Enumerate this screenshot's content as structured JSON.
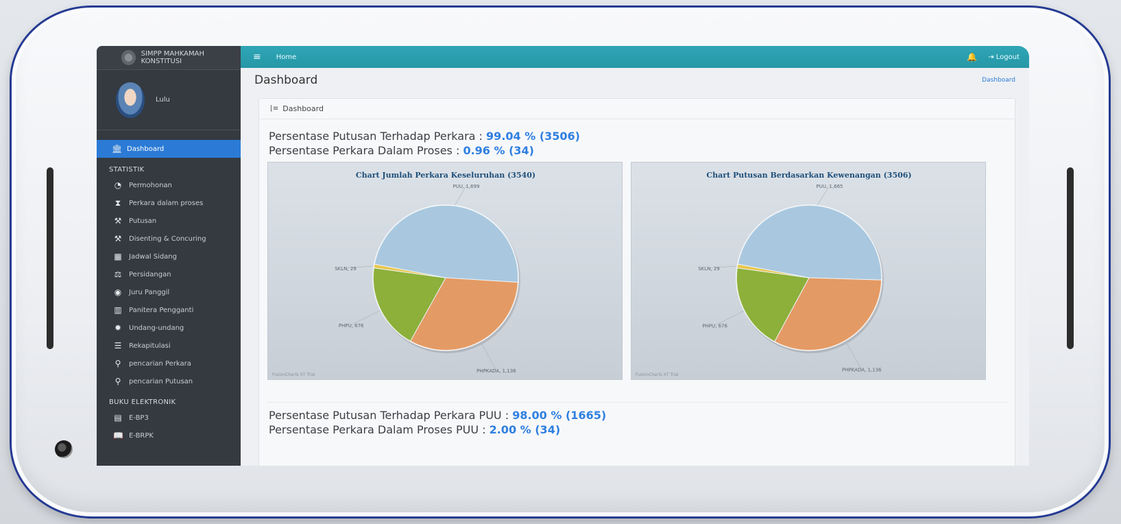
{
  "app": {
    "brand": "SIMPP MAHKAMAH KONSTITUSI",
    "user_name": "Lulu"
  },
  "topbar": {
    "home_label": "Home",
    "logout_label": "Logout"
  },
  "sidebar": {
    "active_item": {
      "label": "Dashboard",
      "icon": "bank-icon"
    },
    "sections": [
      {
        "header": "STATISTIK",
        "items": [
          {
            "label": "Permohonan",
            "icon": "pie-chart-icon"
          },
          {
            "label": "Perkara dalam proses",
            "icon": "hourglass-icon"
          },
          {
            "label": "Putusan",
            "icon": "gavel-icon"
          },
          {
            "label": "Disenting & Concuring",
            "icon": "gavel-icon"
          },
          {
            "label": "Jadwal Sidang",
            "icon": "calendar-icon"
          },
          {
            "label": "Persidangan",
            "icon": "scale-icon"
          },
          {
            "label": "Juru Panggil",
            "icon": "user-circle-icon"
          },
          {
            "label": "Panitera Pengganti",
            "icon": "building-icon"
          },
          {
            "label": "Undang-undang",
            "icon": "gear-icon"
          },
          {
            "label": "Rekapitulasi",
            "icon": "list-icon"
          },
          {
            "label": "pencarian Perkara",
            "icon": "search-icon"
          },
          {
            "label": "pencarian Putusan",
            "icon": "search-icon"
          }
        ]
      },
      {
        "header": "BUKU ELEKTRONIK",
        "items": [
          {
            "label": "E-BP3",
            "icon": "book-icon"
          },
          {
            "label": "E-BRPK",
            "icon": "open-book-icon"
          }
        ]
      }
    ]
  },
  "main": {
    "page_title": "Dashboard",
    "breadcrumb": "Dashboard",
    "card_title": "Dashboard",
    "stats_top": [
      {
        "label": "Persentase Putusan Terhadap Perkara :",
        "value": "99.04 % (3506)"
      },
      {
        "label": "Persentase Perkara Dalam Proses :",
        "value": "0.96 % (34)"
      }
    ],
    "stats_bottom": [
      {
        "label": "Persentase Putusan Terhadap Perkara PUU :",
        "value": "98.00 % (1665)"
      },
      {
        "label": "Persentase Perkara Dalam Proses PUU :",
        "value": "2.00 % (34)"
      }
    ],
    "watermark": "FusionCharts XT Trial"
  },
  "colors": {
    "accent": "#2b7bd6",
    "topbar": "#2a9fb0",
    "sidebar": "#343a40",
    "slice_puu": "#a9c8df",
    "slice_phpkada": "#e49a64",
    "slice_phpu": "#8cb03a",
    "slice_skln": "#e8c64a"
  },
  "chart_data": [
    {
      "type": "pie",
      "title": "Chart Jumlah Perkara Keseluruhan (3540)",
      "slices": [
        {
          "label": "PUU",
          "value": 1699,
          "display": "PUU, 1,699"
        },
        {
          "label": "PHPKADA",
          "value": 1136,
          "display": "PHPKADA, 1,136"
        },
        {
          "label": "PHPU",
          "value": 676,
          "display": "PHPU, 676"
        },
        {
          "label": "SKLN",
          "value": 29,
          "display": "SKLN, 29"
        }
      ]
    },
    {
      "type": "pie",
      "title": "Chart Putusan Berdasarkan Kewenangan (3506)",
      "slices": [
        {
          "label": "PUU",
          "value": 1665,
          "display": "PUU, 1,665"
        },
        {
          "label": "PHPKADA",
          "value": 1136,
          "display": "PHPKADA, 1,136"
        },
        {
          "label": "PHPU",
          "value": 676,
          "display": "PHPU, 676"
        },
        {
          "label": "SKLN",
          "value": 29,
          "display": "SKLN, 29"
        }
      ]
    }
  ]
}
